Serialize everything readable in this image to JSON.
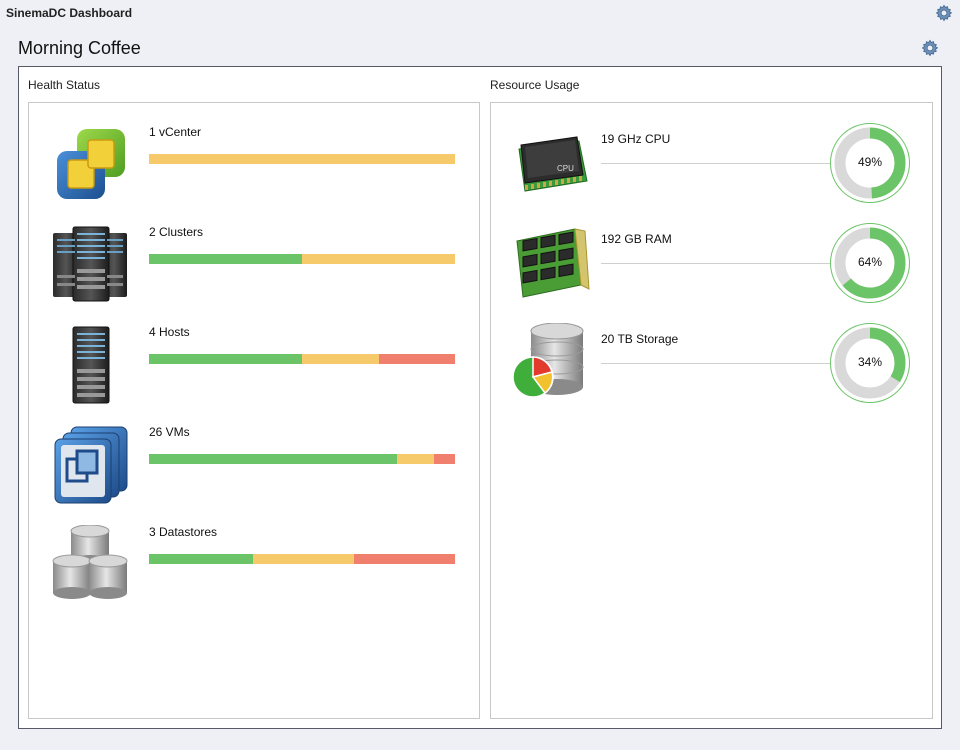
{
  "app": {
    "title": "SinemaDC Dashboard"
  },
  "page": {
    "title": "Morning Coffee"
  },
  "icons": {
    "settings_top": "gear-icon",
    "settings_page": "gear-icon"
  },
  "colors": {
    "ok": "#6bc467",
    "warning": "#f6c96b",
    "critical": "#f0806d",
    "gauge_track": "#d9d9d9",
    "gauge_fill": "#6bc467"
  },
  "health": {
    "title": "Health Status",
    "items": [
      {
        "label": "1 vCenter",
        "icon": "vcenter-icon",
        "ok": 0,
        "warning": 100,
        "critical": 0
      },
      {
        "label": "2 Clusters",
        "icon": "clusters-icon",
        "ok": 50,
        "warning": 50,
        "critical": 0
      },
      {
        "label": "4 Hosts",
        "icon": "hosts-icon",
        "ok": 50,
        "warning": 25,
        "critical": 25
      },
      {
        "label": "26 VMs",
        "icon": "vms-icon",
        "ok": 81,
        "warning": 12,
        "critical": 7
      },
      {
        "label": "3 Datastores",
        "icon": "datastores-icon",
        "ok": 34,
        "warning": 33,
        "critical": 33
      }
    ]
  },
  "resources": {
    "title": "Resource Usage",
    "items": [
      {
        "label": "19 GHz CPU",
        "icon": "cpu-icon",
        "icon_text": "CPU",
        "percent": 49,
        "percent_label": "49%"
      },
      {
        "label": "192 GB RAM",
        "icon": "ram-icon",
        "percent": 64,
        "percent_label": "64%"
      },
      {
        "label": "20 TB Storage",
        "icon": "storage-icon",
        "percent": 34,
        "percent_label": "34%"
      }
    ]
  }
}
